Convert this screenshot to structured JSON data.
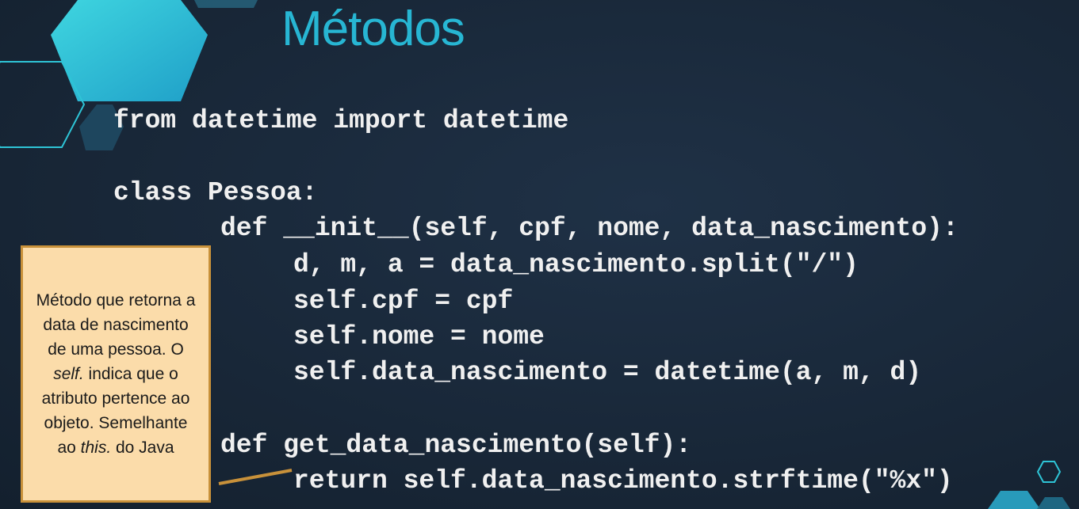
{
  "slide": {
    "title": "Métodos",
    "code_lines": [
      "from datetime import datetime",
      "class Pessoa:",
      "def __init__(self, cpf, nome, data_nascimento):",
      "d, m, a = data_nascimento.split(\"/\")",
      "self.cpf = cpf",
      "self.nome = nome",
      "self.data_nascimento = datetime(a, m, d)",
      "def get_data_nascimento(self):",
      "return self.data_nascimento.strftime(\"%x\")"
    ],
    "note": {
      "part1": "Método que retorna a data de nascimento de uma pessoa. O ",
      "self_word": "self.",
      "part2": " indica que o atributo pertence ao objeto. Semelhante ao ",
      "this_word": "this.",
      "part3": " do Java"
    }
  },
  "colors": {
    "background": "#1b2a3a",
    "title": "#27b6d3",
    "code": "#f0f0f0",
    "note_bg": "#fbdcaa",
    "note_border": "#c8913a",
    "hex_accent": "#2ec4d6"
  }
}
